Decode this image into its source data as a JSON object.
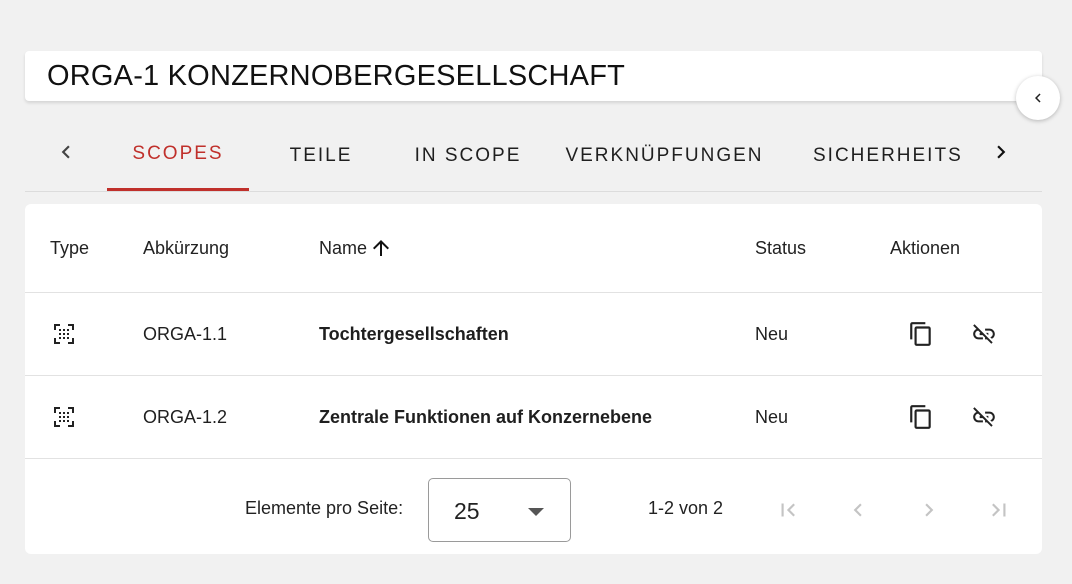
{
  "header": {
    "title": "ORGA-1 KONZERNOBERGESELLSCHAFT",
    "collapse_icon": "chevron-left-icon"
  },
  "tabs": [
    {
      "label": "SCOPES",
      "active": true
    },
    {
      "label": "TEILE",
      "active": false
    },
    {
      "label": "IN SCOPE",
      "active": false
    },
    {
      "label": "VERKNÜPFUNGEN",
      "active": false
    },
    {
      "label": "SICHERHEITSMASSNAHMEN",
      "active": false
    }
  ],
  "table": {
    "columns": {
      "type": "Type",
      "abbr": "Abkürzung",
      "name": "Name",
      "status": "Status",
      "actions": "Aktionen"
    },
    "sort": {
      "column": "name",
      "direction": "ascending",
      "icon": "arrow-up-icon"
    },
    "rows": [
      {
        "type_icon": "scope-icon",
        "abbr": "ORGA-1.1",
        "name": "Tochtergesellschaften",
        "status": "Neu"
      },
      {
        "type_icon": "scope-icon",
        "abbr": "ORGA-1.2",
        "name": "Zentrale Funktionen auf Konzernebene",
        "status": "Neu"
      }
    ],
    "row_actions": [
      "copy-icon",
      "unlink-icon"
    ]
  },
  "pagination": {
    "per_page_label": "Elemente pro Seite:",
    "per_page_value": "25",
    "range_text": "1-2 von 2"
  },
  "colors": {
    "accent": "#c0302b",
    "background": "#f1f1f1",
    "card": "#ffffff"
  }
}
